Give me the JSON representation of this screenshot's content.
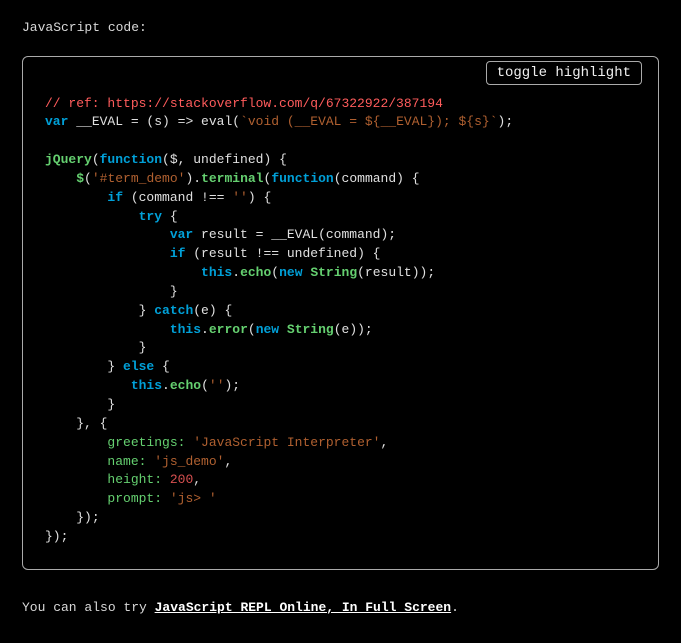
{
  "lead_label": "JavaScript code:",
  "toggle_label": "toggle highlight",
  "footer": {
    "prefix": "You can also try ",
    "link_text": "JavaScript REPL Online, In Full Screen",
    "suffix": "."
  },
  "code": {
    "comment1": "// ref: https://stackoverflow.com/q/67322922/387194",
    "kw_var": "var",
    "eval_name": "__EVAL",
    "eval_rhs1": " = (s) => eval(",
    "eval_tpl": "`void (__EVAL = ${__EVAL}); ${s}`",
    "eval_rhs2": ");",
    "jq": "jQuery",
    "fn_kw": "function",
    "fn_args1": "($, undefined) {",
    "dollar": "$",
    "sel_str": "'#term_demo'",
    "term": "terminal",
    "cmd_arg": "(command) {",
    "kw_if": "if",
    "cond1": " (command !== ",
    "empty": "''",
    "brace_close_then_open": ") {",
    "kw_try": "try",
    "try_open": " {",
    "result": "result",
    "assign_eval": " = __EVAL(command);",
    "cond2": " (result !== undefined) {",
    "this_kw": "this",
    "echo": "echo",
    "new_kw": "new",
    "string": "String",
    "of_result": "(result));",
    "kw_catch": "catch",
    "catch_arg": "(e) {",
    "error": "error",
    "of_e": "(e));",
    "kw_else": "else",
    "greetings_k": "greetings:",
    "greetings_v": "'JavaScript Interpreter'",
    "name_k": "name:",
    "name_v": "'js_demo'",
    "height_k": "height:",
    "height_v": "200",
    "prompt_k": "prompt:",
    "prompt_v": "'js> '"
  }
}
